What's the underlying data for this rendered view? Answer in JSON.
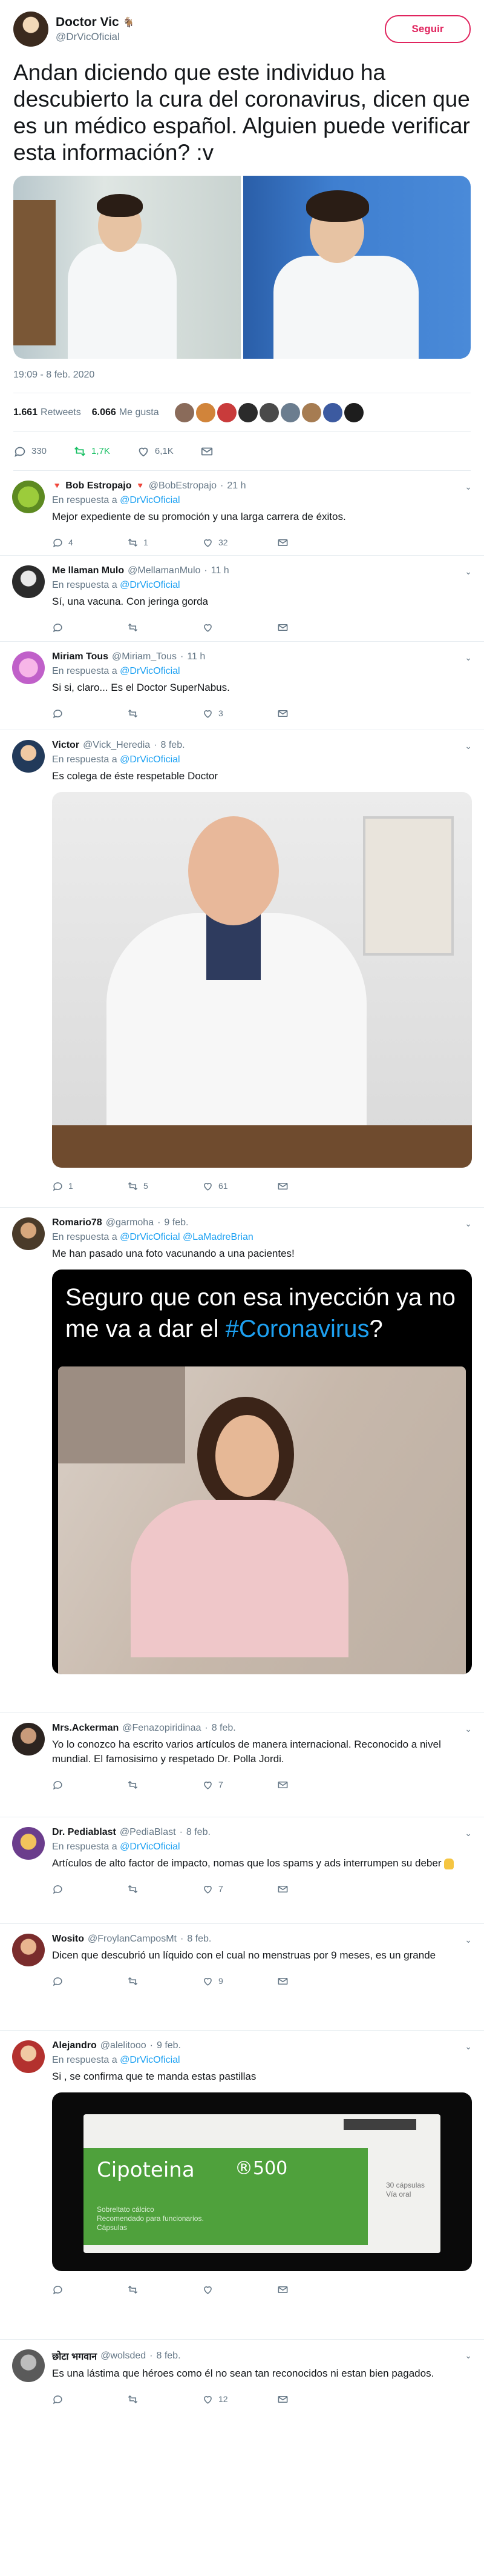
{
  "main": {
    "author_name": "Doctor Vic",
    "author_handle": "@DrVicOficial",
    "follow_label": "Seguir",
    "text": "Andan diciendo que este individuo ha descubierto la cura del coronavirus, dicen que es un médico español. Alguien puede verificar esta información? :v",
    "timestamp": "19:09 - 8 feb. 2020",
    "retweets_count": "1.661",
    "retweets_label": "Retweets",
    "likes_count": "6.066",
    "likes_label": "Me gusta",
    "reply_count": "330",
    "retweet_count_short": "1,7K",
    "like_count_short": "6,1K"
  },
  "in_reply_label": "En respuesta a",
  "replies": [
    {
      "name": "Bob Estropajo",
      "handle": "@BobEstropajo",
      "time": "21 h",
      "reply_to": "@DrVicOficial",
      "text": "Mejor expediente de su promoción y una larga carrera de éxitos.",
      "replies": "4",
      "retweets": "1",
      "likes": "32"
    },
    {
      "name": "Me llaman Mulo",
      "handle": "@MellamanMulo",
      "time": "11 h",
      "reply_to": "@DrVicOficial",
      "text": "Sí, una vacuna. Con jeringa gorda",
      "replies": "",
      "retweets": "",
      "likes": ""
    },
    {
      "name": "Miriam Tous",
      "handle": "@Miriam_Tous",
      "time": "11 h",
      "reply_to": "@DrVicOficial",
      "text": "Si si, claro... Es el Doctor SuperNabus.",
      "replies": "",
      "retweets": "",
      "likes": "3"
    },
    {
      "name": "Victor",
      "handle": "@Vick_Heredia",
      "time": "8 feb.",
      "reply_to": "@DrVicOficial",
      "text": "Es colega de éste respetable Doctor",
      "replies": "1",
      "retweets": "5",
      "likes": "61"
    },
    {
      "name": "Romario78",
      "handle": "@garmoha",
      "time": "9 feb.",
      "reply_to": "@DrVicOficial",
      "reply_to_2": "@LaMadreBrian",
      "text": "Me han pasado una foto vacunando a una pacientes!",
      "meme_text": "Seguro que con esa inyección ya no me va a dar el",
      "meme_hashtag": "#Coronavirus",
      "meme_end": "?"
    },
    {
      "name": "Mrs.Ackerman",
      "handle": "@Fenazopiridinaa",
      "time": "8 feb.",
      "text": "Yo lo conozco ha escrito varios artículos de manera internacional. Reconocido a nivel mundial. El famosisimo y respetado Dr. Polla Jordi.",
      "replies": "",
      "retweets": "",
      "likes": "7"
    },
    {
      "name": "Dr. Pediablast",
      "handle": "@PediaBlast",
      "time": "8 feb.",
      "reply_to": "@DrVicOficial",
      "text": "Artículos de alto factor de impacto, nomas que los spams y ads interrumpen su deber",
      "replies": "",
      "retweets": "",
      "likes": "7"
    },
    {
      "name": "Wosito",
      "handle": "@FroylanCamposMt",
      "time": "8 feb.",
      "text": "Dicen que descubrió un líquido con el cual no menstruas por 9 meses, es un grande",
      "replies": "",
      "retweets": "",
      "likes": "9"
    },
    {
      "name": "Alejandro",
      "handle": "@alelitooo",
      "time": "9 feb.",
      "reply_to": "@DrVicOficial",
      "text": "Si , se confirma que te manda estas pastillas",
      "box_brand": "Cipoteina",
      "box_dose": "®500",
      "box_sub_1": "Sobreltato cálcico",
      "box_sub_2": "Recomendado para funcionarios.",
      "box_sub_3": "Cápsulas",
      "box_side_1": "30 cápsulas",
      "box_side_2": "Vía oral",
      "replies": "",
      "retweets": "",
      "likes": ""
    },
    {
      "name": "छोटा भगवान",
      "handle": "@wolsded",
      "time": "8 feb.",
      "text": "Es una lástima que héroes como él no sean tan reconocidos ni estan bien pagados.",
      "replies": "",
      "retweets": "",
      "likes": "12"
    }
  ]
}
